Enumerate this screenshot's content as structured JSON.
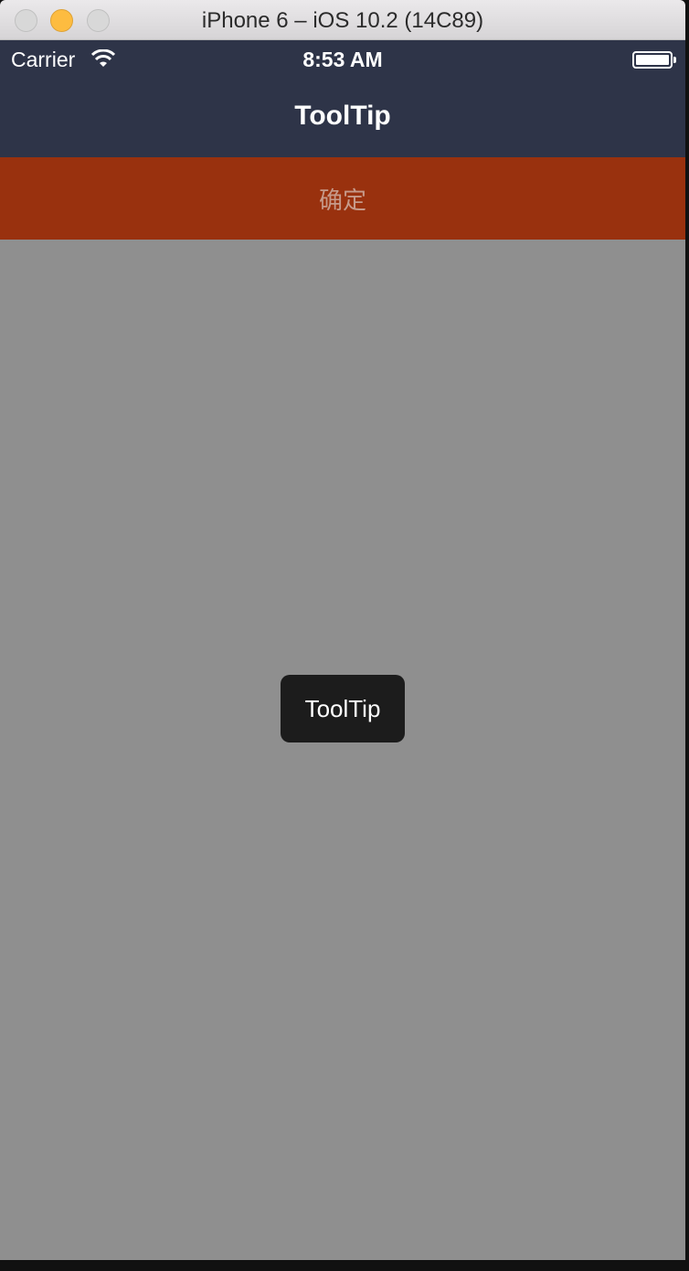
{
  "window": {
    "title": "iPhone 6 – iOS 10.2 (14C89)"
  },
  "status_bar": {
    "carrier": "Carrier",
    "time": "8:53 AM",
    "battery_percent": 100
  },
  "nav": {
    "title": "ToolTip"
  },
  "confirm_button": {
    "label": "确定"
  },
  "tooltip": {
    "text": "ToolTip"
  },
  "colors": {
    "nav_bg": "#2e3448",
    "button_bg": "#99310e",
    "screen_bg": "#8f8f8f",
    "tooltip_bg": "#1c1c1c"
  }
}
